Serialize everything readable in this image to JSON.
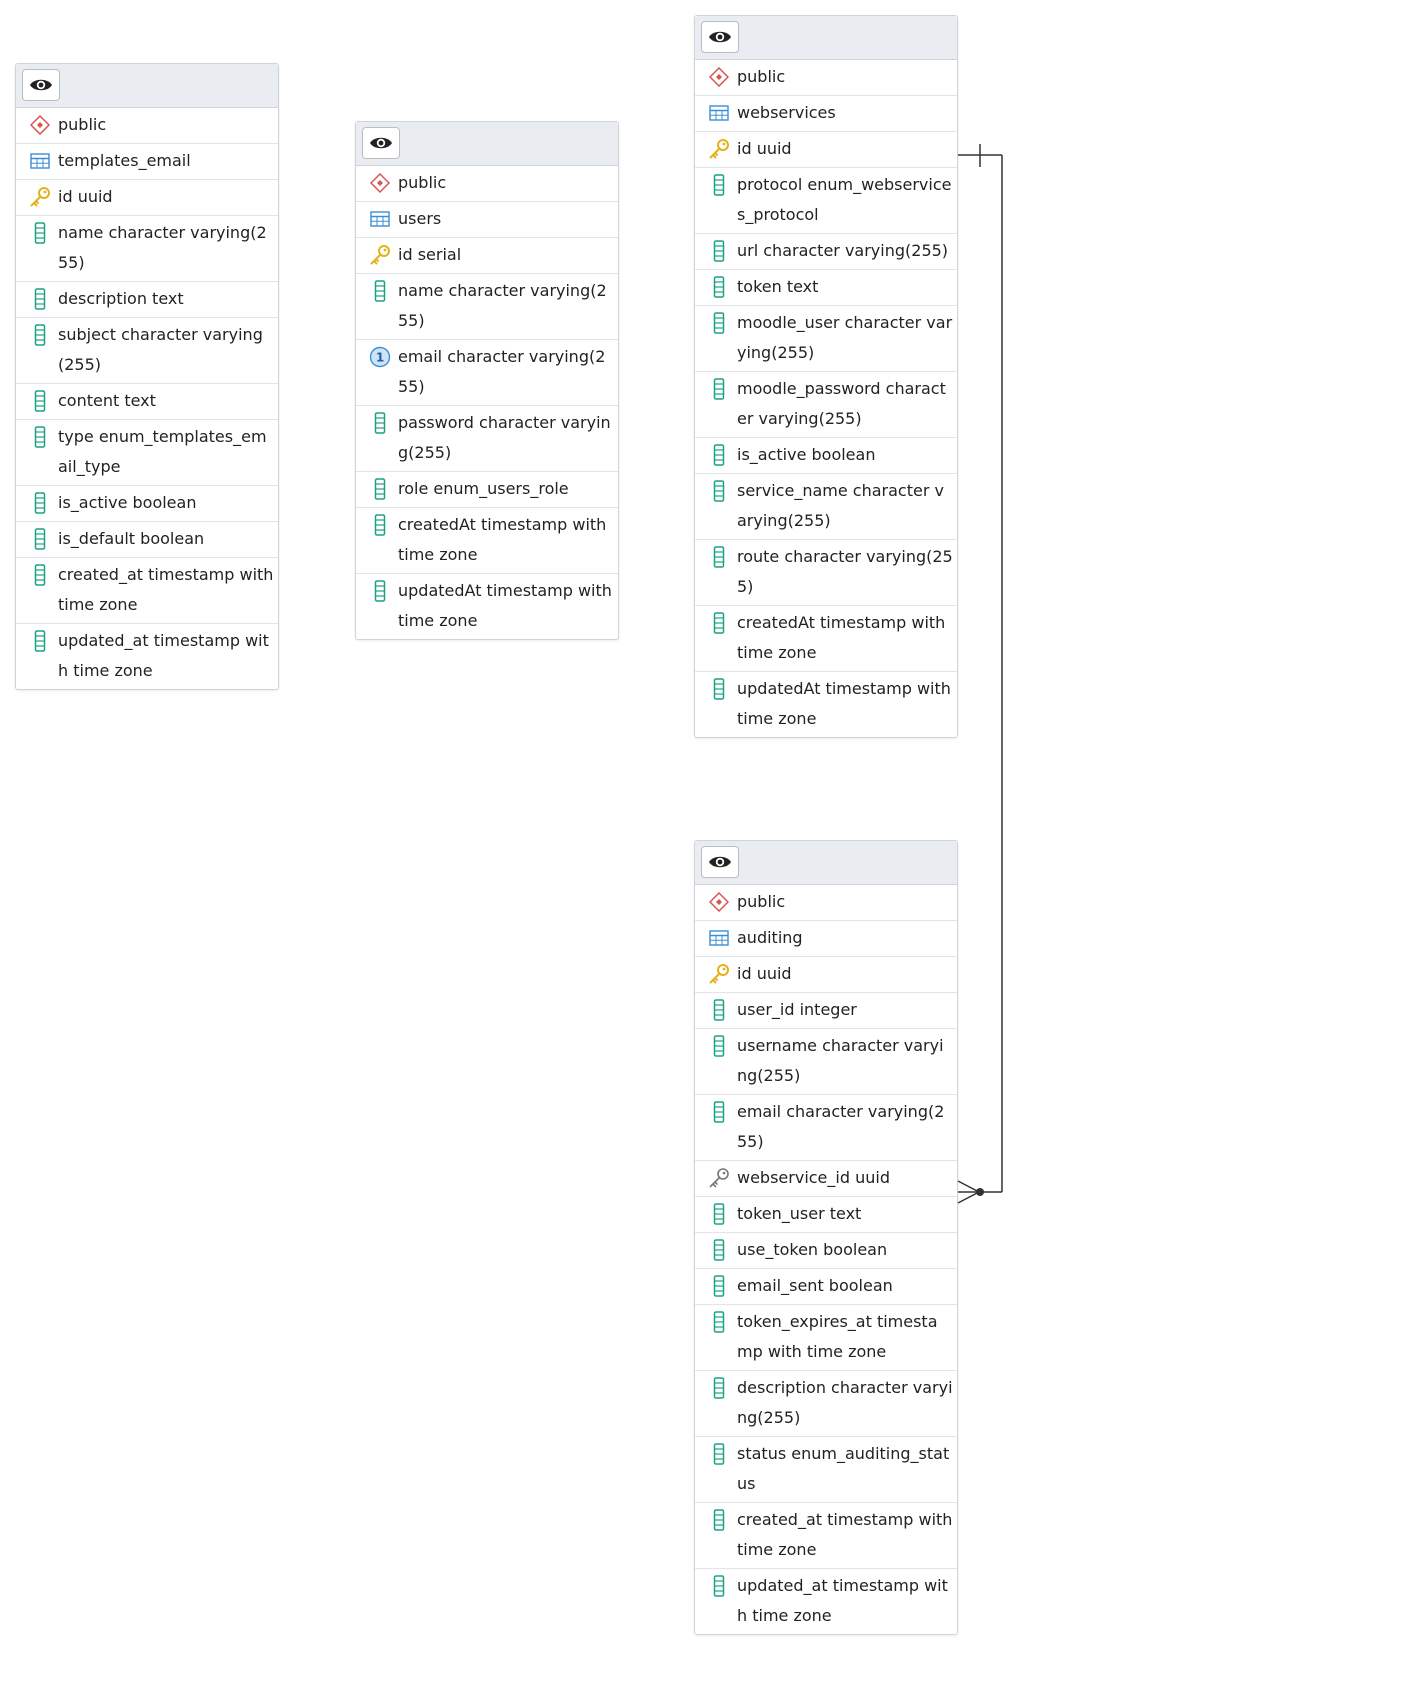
{
  "tables": [
    {
      "name": "templates_email",
      "schema": "public",
      "columns": [
        {
          "icon": "primary-key-icon",
          "label": "id uuid"
        },
        {
          "icon": "column-icon",
          "label": "name character varying(255)"
        },
        {
          "icon": "column-icon",
          "label": "description text"
        },
        {
          "icon": "column-icon",
          "label": "subject character varying(255)"
        },
        {
          "icon": "column-icon",
          "label": "content text"
        },
        {
          "icon": "column-icon",
          "label": "type enum_templates_email_type"
        },
        {
          "icon": "column-icon",
          "label": "is_active boolean"
        },
        {
          "icon": "column-icon",
          "label": "is_default boolean"
        },
        {
          "icon": "column-icon",
          "label": "created_at timestamp with time zone"
        },
        {
          "icon": "column-icon",
          "label": "updated_at timestamp with time zone"
        }
      ]
    },
    {
      "name": "users",
      "schema": "public",
      "columns": [
        {
          "icon": "primary-key-icon",
          "label": "id serial"
        },
        {
          "icon": "column-icon",
          "label": "name character varying(255)"
        },
        {
          "icon": "unique-icon",
          "label": "email character varying(255)"
        },
        {
          "icon": "column-icon",
          "label": "password character varying(255)"
        },
        {
          "icon": "column-icon",
          "label": "role enum_users_role"
        },
        {
          "icon": "column-icon",
          "label": "createdAt timestamp with time zone"
        },
        {
          "icon": "column-icon",
          "label": "updatedAt timestamp with time zone"
        }
      ]
    },
    {
      "name": "webservices",
      "schema": "public",
      "columns": [
        {
          "icon": "primary-key-icon",
          "label": "id uuid"
        },
        {
          "icon": "column-icon",
          "label": "protocol enum_webservices_protocol"
        },
        {
          "icon": "column-icon",
          "label": "url character varying(255)"
        },
        {
          "icon": "column-icon",
          "label": "token text"
        },
        {
          "icon": "column-icon",
          "label": "moodle_user character varying(255)"
        },
        {
          "icon": "column-icon",
          "label": "moodle_password character varying(255)"
        },
        {
          "icon": "column-icon",
          "label": "is_active boolean"
        },
        {
          "icon": "column-icon",
          "label": "service_name character varying(255)"
        },
        {
          "icon": "column-icon",
          "label": "route character varying(255)"
        },
        {
          "icon": "column-icon",
          "label": "createdAt timestamp with time zone"
        },
        {
          "icon": "column-icon",
          "label": "updatedAt timestamp with time zone"
        }
      ]
    },
    {
      "name": "auditing",
      "schema": "public",
      "columns": [
        {
          "icon": "primary-key-icon",
          "label": "id uuid"
        },
        {
          "icon": "column-icon",
          "label": "user_id integer"
        },
        {
          "icon": "column-icon",
          "label": "username character varying(255)"
        },
        {
          "icon": "column-icon",
          "label": "email character varying(255)"
        },
        {
          "icon": "foreign-key-icon",
          "label": "webservice_id uuid"
        },
        {
          "icon": "column-icon",
          "label": "token_user text"
        },
        {
          "icon": "column-icon",
          "label": "use_token boolean"
        },
        {
          "icon": "column-icon",
          "label": "email_sent boolean"
        },
        {
          "icon": "column-icon",
          "label": "token_expires_at timestamp with time zone"
        },
        {
          "icon": "column-icon",
          "label": "description character varying(255)"
        },
        {
          "icon": "column-icon",
          "label": "status enum_auditing_status"
        },
        {
          "icon": "column-icon",
          "label": "created_at timestamp with time zone"
        },
        {
          "icon": "column-icon",
          "label": "updated_at timestamp with time zone"
        }
      ]
    }
  ],
  "relationships": [
    {
      "from_table": "auditing",
      "from_column": "webservice_id uuid",
      "to_table": "webservices",
      "to_column": "id uuid",
      "cardinality": "many-to-one"
    }
  ],
  "colors": {
    "schema_icon": "#d9534f",
    "table_icon": "#3b8fd6",
    "key_icon": "#e3b21a",
    "column_icon": "#1aa383",
    "unique_icon": "#3b8fd6",
    "fk_icon": "#777777",
    "header_bg": "#e9ecf0",
    "relation_line": "#333333"
  }
}
